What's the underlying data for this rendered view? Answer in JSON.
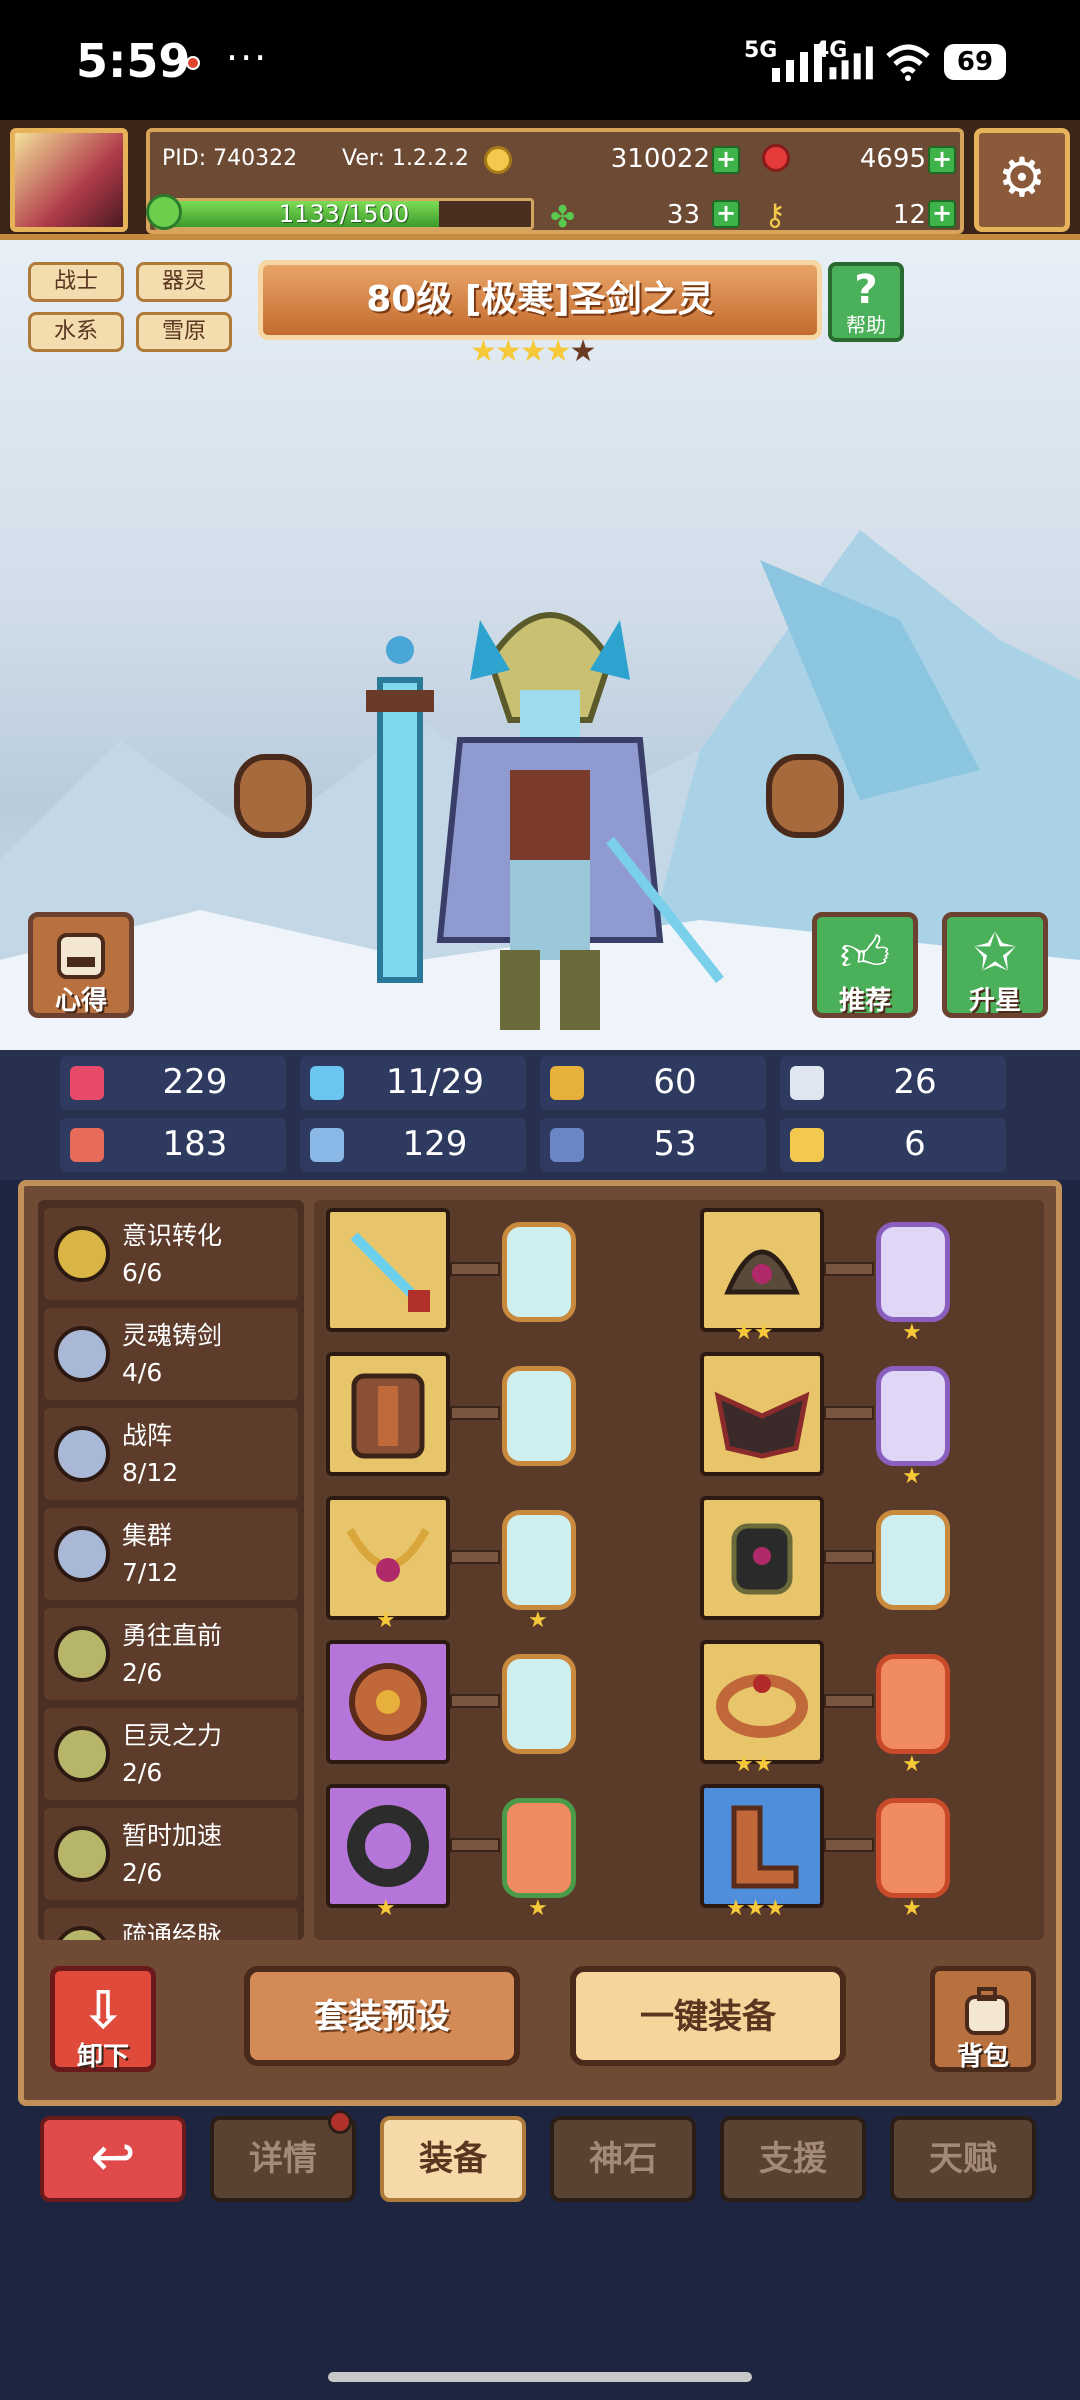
{
  "status_bar": {
    "time": "5:59",
    "more": "···",
    "network_5g": "5G",
    "network_4g": "4G",
    "battery": "69"
  },
  "header": {
    "pid": "PID: 740322",
    "version": "Ver: 1.2.2.2",
    "gold": "310022",
    "gems": "4695",
    "stamina": "1133/1500",
    "stamina_fraction": 0.755,
    "clover": "33",
    "key": "12"
  },
  "hero": {
    "tags": [
      "战士",
      "器灵",
      "水系",
      "雪原"
    ],
    "title": "80级 [极寒]圣剑之灵",
    "stars_filled": 4,
    "stars_total": 5,
    "help_label": "帮助",
    "notes_label": "心得",
    "recommend_label": "推荐",
    "starup_label": "升星"
  },
  "stats": [
    {
      "icon": "heart-icon",
      "value": "229"
    },
    {
      "icon": "mana-drop-icon",
      "value": "11/29"
    },
    {
      "icon": "shield-icon",
      "value": "60"
    },
    {
      "icon": "wing-icon",
      "value": "26"
    },
    {
      "icon": "fist-icon",
      "value": "183"
    },
    {
      "icon": "book-icon",
      "value": "129"
    },
    {
      "icon": "boot-icon",
      "value": "53"
    },
    {
      "icon": "horseshoe-icon",
      "value": "6"
    }
  ],
  "sets": [
    {
      "name": "意识转化",
      "progress": "6/6",
      "color": "#d8b544"
    },
    {
      "name": "灵魂铸剑",
      "progress": "4/6",
      "color": "#aab8d8"
    },
    {
      "name": "战阵",
      "progress": "8/12",
      "color": "#aab8d8"
    },
    {
      "name": "集群",
      "progress": "7/12",
      "color": "#aab8d8"
    },
    {
      "name": "勇往直前",
      "progress": "2/6",
      "color": "#b7b56a"
    },
    {
      "name": "巨灵之力",
      "progress": "2/6",
      "color": "#b7b56a"
    },
    {
      "name": "暂时加速",
      "progress": "2/6",
      "color": "#b7b56a"
    },
    {
      "name": "疏通经脉",
      "progress": "",
      "color": "#b7b56a"
    }
  ],
  "actions": {
    "unequip": "卸下",
    "preset": "套装预设",
    "equip_all": "一键装备",
    "backpack": "背包"
  },
  "tabs": [
    "详情",
    "装备",
    "神石",
    "支援",
    "天赋"
  ],
  "active_tab": "装备"
}
